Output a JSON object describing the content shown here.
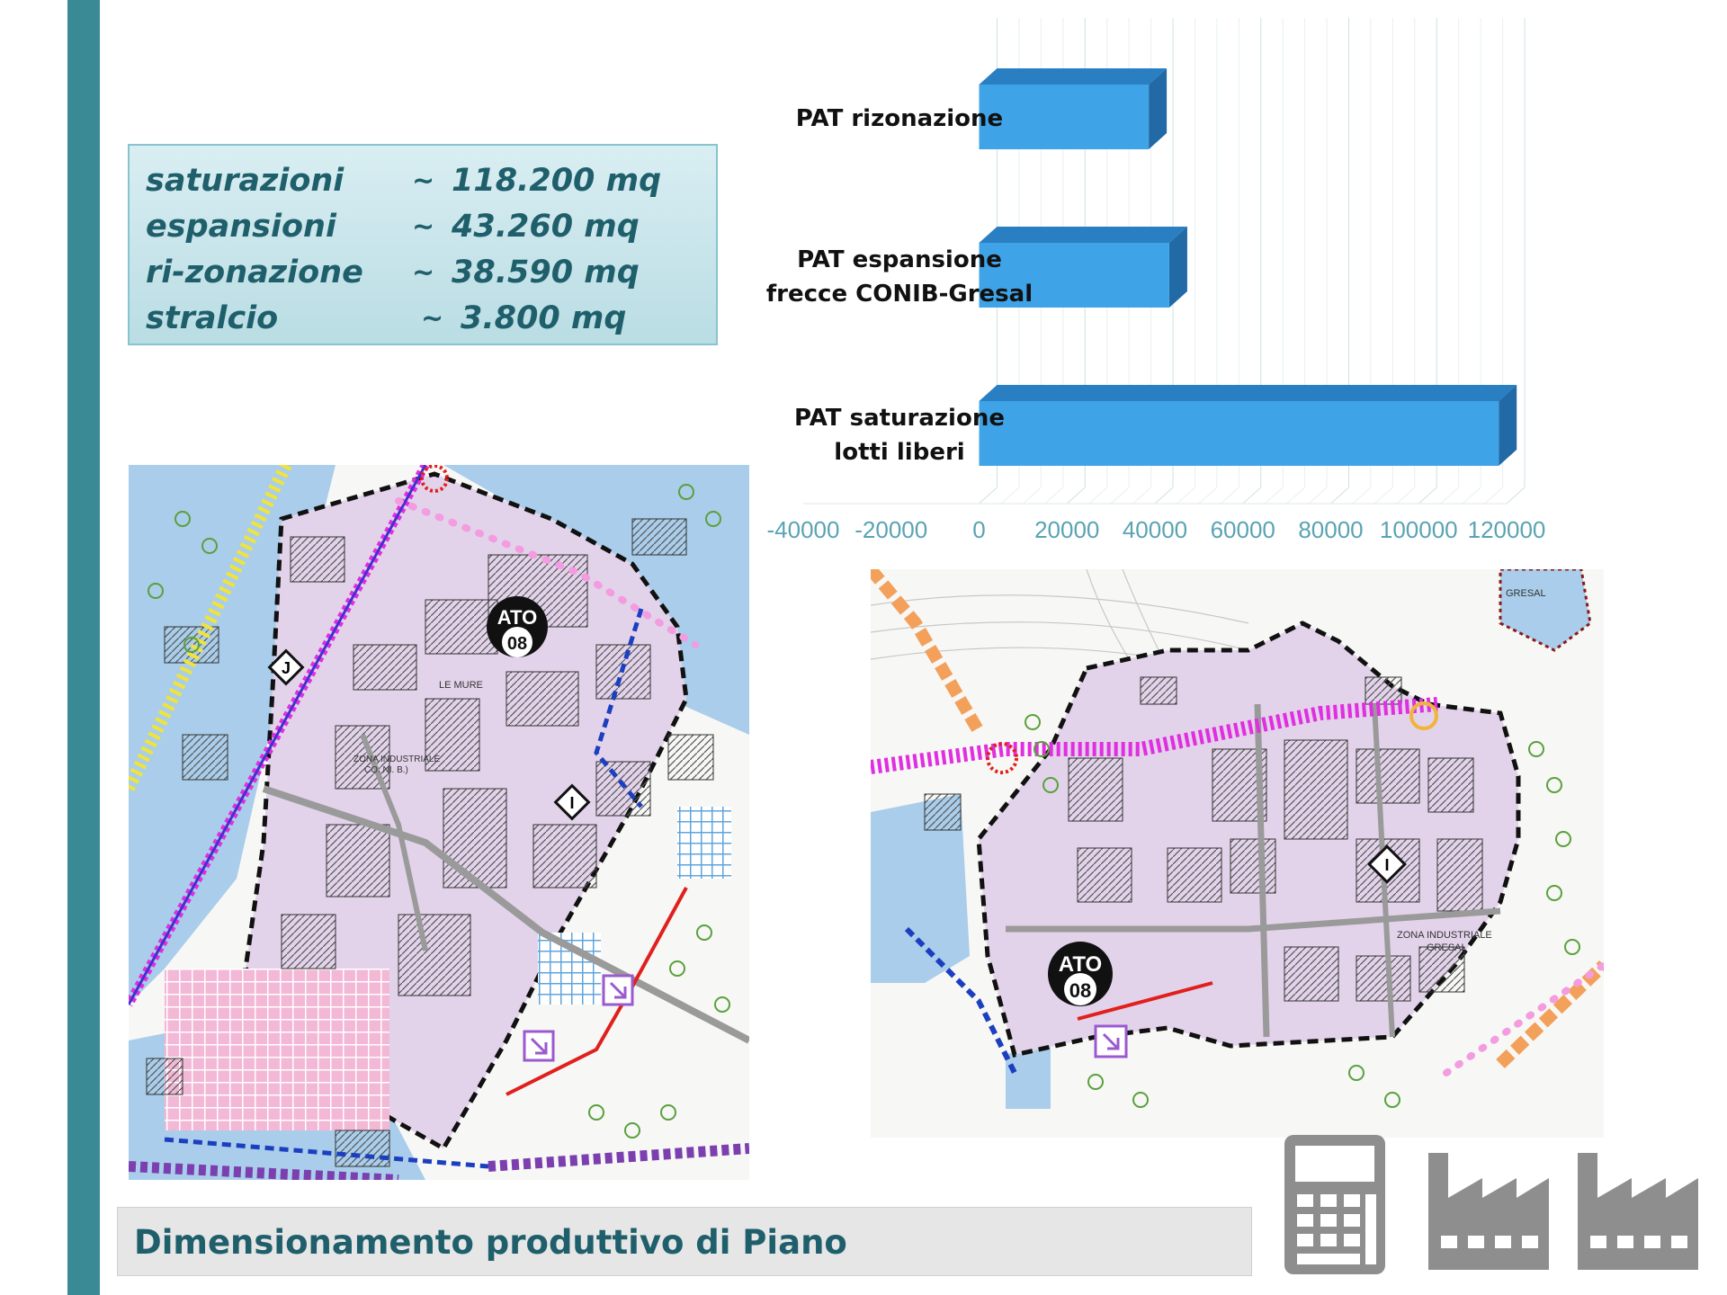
{
  "stats": [
    {
      "label": "saturazioni",
      "tilde": "~",
      "value": "118.200 mq"
    },
    {
      "label": "espansioni",
      "tilde": "~",
      "value": "43.260 mq"
    },
    {
      "label": "ri-zonazione",
      "tilde": "~",
      "value": "38.590 mq"
    },
    {
      "label": "stralcio",
      "tilde": "~",
      "value": "3.800 mq"
    }
  ],
  "chart_data": {
    "type": "bar",
    "orientation": "horizontal",
    "style": "3d",
    "categories": [
      [
        "PAT rizonazione"
      ],
      [
        "PAT espansione",
        "frecce CONIB-Gresal"
      ],
      [
        "PAT saturazione",
        "lotti liberi"
      ]
    ],
    "values": [
      38590,
      43260,
      118200
    ],
    "xlim": [
      -40000,
      120000
    ],
    "ticks": [
      "-40000",
      "-20000",
      "0",
      "20000",
      "40000",
      "60000",
      "80000",
      "100000",
      "120000"
    ],
    "tick_values": [
      -40000,
      -20000,
      0,
      20000,
      40000,
      60000,
      80000,
      100000,
      120000
    ],
    "grid": true,
    "bar_color": "#3fa3e8",
    "title": "",
    "xlabel": "",
    "ylabel": ""
  },
  "maps": {
    "left": {
      "ato_top": "ATO",
      "ato_num": "08",
      "label_le_mure": "LE MURE",
      "label_zona_1": "ZONA INDUSTRIALE",
      "label_zona_2": "CO. NI. B.)",
      "marker_j": "J",
      "marker_i": "I"
    },
    "right": {
      "ato_top": "ATO",
      "ato_num": "08",
      "label_zona_1": "ZONA INDUSTRIALE",
      "label_zona_2": "GRESAL",
      "label_gresal": "GRESAL",
      "marker_i": "I"
    }
  },
  "footer": {
    "title": "Dimensionamento produttivo di Piano"
  },
  "colors": {
    "accent": "#3a8a96",
    "title_text": "#1f5f6b",
    "zone_pink": "#e2d3ea",
    "zone_blue": "#a9cdea",
    "icon_gray": "#8e8e8e"
  },
  "icons": [
    "calculator-icon",
    "factory-icon",
    "factory-icon"
  ]
}
